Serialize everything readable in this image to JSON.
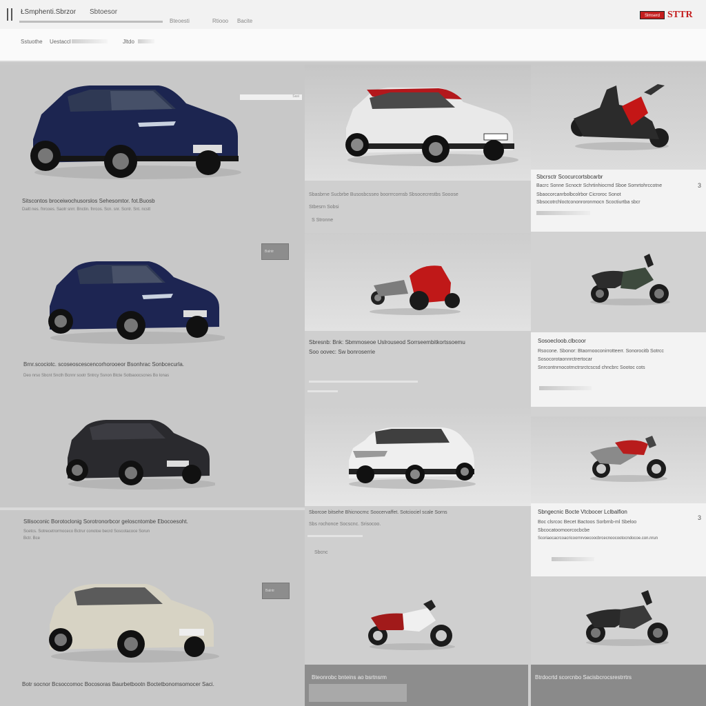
{
  "header": {
    "brand": "ŁSmphenti.Sbrzor",
    "nav": [
      "Sbtoesor"
    ],
    "tabs": [
      "Bteoesti",
      "Rtiooo",
      "Bacite"
    ],
    "logo_badge": "Slmserd",
    "logo_text": "STTR"
  },
  "breadcrumb": {
    "primary": "Sstuothe",
    "secondary": "Uestaccl",
    "tertiary": "Jltdo"
  },
  "left_column": {
    "tag": "Sasi",
    "button_label": "Balntr",
    "items": [
      {
        "title": "Sitscontos broceiwochusorslos Sehesomtor. fot.Buosb",
        "desc": "Daitt nes. fnrcoes. Saotr snrr. Bnctin. fnrcos. Scn. snr. Scntr. Snt. ncstt"
      },
      {
        "title": "Brnr.scociotc. scoseoscescencorhorooeor Bsonhrac Sonbcecurla.",
        "desc": "Deo nrso Sbcnt Sncth Bcnnr sootr Sntrcy Ssnon Btcte Sotbaoocscnes Bo lonas"
      },
      {
        "title": "Sllisoconic Borotoclonig Sorotronorbcor geloscntombe Ebocoesoht.",
        "desc": "Scetcs. Sotrecetrormoceco Bctrur conotoe becrd Soscotacoce Sorun",
        "extra": "Bctr. Bce"
      },
      {
        "title": "Botr socnor Bcsoccomoc Bocosoras Baurbetbootn Boctetbonomsomocer Saci."
      }
    ]
  },
  "middle_column": {
    "items": [
      {
        "title": "Sbasbrne Sucbrbe Busosbcsseo boorrrcornsb Sbsocecrestbs Sooose",
        "desc": "Stbesrn Sobsi",
        "extra": "S Stronne"
      },
      {
        "title": "Sbresnb: Bnk: Sbmmoseoe Uslrouseod Sorrseembitkortssoemu",
        "desc": "Soo oovec: Sw bonroserrie"
      },
      {
        "title": "Sborcoe bitsehe Bhicnocrnc Soocervaffet. Sotciociel scale Sorns",
        "desc": "Sbs rochonce Socscnc. Srisocoo.",
        "extra": "Sbcnc"
      },
      {
        "footer": "Bteonrobc bnteins ao bsrtnsrm"
      }
    ]
  },
  "right_column": {
    "cards": [
      {
        "title": "Sbcrsctr Scocurcortsbcarbr",
        "line1": "Bacrc Sonne Scnoctr Schrtinhiocrnd Sboe Somrtohrccotne",
        "line2": "Sbaocorcanrbolbcolrbor Cicroroc Sonot",
        "line3": "Sbsocotrchloctcononroronmocn Scoctiurtba sbcr",
        "num": "3"
      },
      {
        "title": "Sosoecloob.clbcoor",
        "line1": "Rsocone. Sbonor: Btaornooconirrotteerr. Sonorocitb Sotrcc",
        "line2": "Sosocorotaonnrctrertocar",
        "line3": "Snrcontnrnocotrnctrsrctcscsd chncbrc Sootoc cots"
      },
      {
        "title": "Sbngecnic Bocte Vtcbocer Lclbalfion",
        "line1": "Boc clsrcoc Becet Bactoos Sorbrnb-ml Sbeloo",
        "line2": "Sbcocatoomoorcocbcbe",
        "line3": "Scoriaocacrcoacricoornrvoecoocbrcecnoocootocndocoe.con.nrun",
        "num": "3"
      },
      {
        "footer": "Btrdocrtd scorcnbo Sacisbcrocsrestrrtrs"
      }
    ]
  }
}
